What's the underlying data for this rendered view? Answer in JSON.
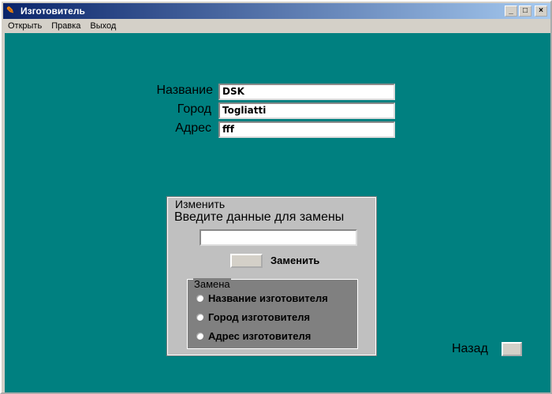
{
  "window": {
    "title": "Изготовитель",
    "minimize": "_",
    "maximize": "□",
    "close": "×"
  },
  "menu": [
    "Открыть",
    "Правка",
    "Выход"
  ],
  "fields": [
    {
      "label": "Название",
      "value": "DSK"
    },
    {
      "label": "Город",
      "value": "Togliatti"
    },
    {
      "label": "Адрес",
      "value": "fff"
    }
  ],
  "change_group": {
    "caption": "Изменить",
    "prompt": "Введите данные для замены",
    "input_value": "",
    "replace_label": "Заменить",
    "replace_group": {
      "caption": "Замена",
      "options": [
        "Название изготовителя",
        "Город изготовителя",
        "Адрес изготовителя"
      ]
    }
  },
  "back_label": "Назад"
}
